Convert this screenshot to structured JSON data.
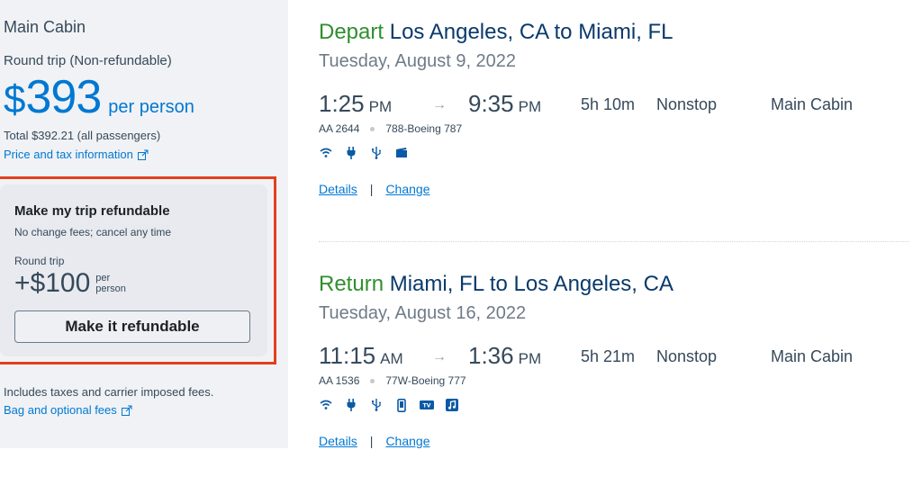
{
  "summary": {
    "cabin": "Main Cabin",
    "trip_type": "Round trip (Non-refundable)",
    "currency": "$",
    "price": "393",
    "per_person": "per person",
    "total": "Total $392.21 (all passengers)",
    "price_tax_link": "Price and tax information",
    "includes": "Includes taxes and carrier imposed fees.",
    "bag_link": "Bag and optional fees"
  },
  "refund": {
    "title": "Make my trip refundable",
    "subtitle": "No change fees; cancel any time",
    "trip_label": "Round trip",
    "amount": "+$100",
    "per_person": "per person",
    "button": "Make it refundable"
  },
  "colors": {
    "accent": "#0078d2",
    "highlight_border": "#e3401c",
    "direction_green": "#2f8f2f"
  },
  "legs": [
    {
      "direction": "Depart",
      "route": "Los Angeles, CA to Miami, FL",
      "date": "Tuesday, August 9, 2022",
      "depart_time": "1:25",
      "depart_ampm": "PM",
      "arrive_time": "9:35",
      "arrive_ampm": "PM",
      "duration": "5h 10m",
      "stops": "Nonstop",
      "cabin": "Main Cabin",
      "flight": "AA 2644",
      "aircraft": "788-Boeing 787",
      "amenities": [
        "wifi-icon",
        "power-icon",
        "usb-icon",
        "entertainment-icon"
      ],
      "details": "Details",
      "change": "Change"
    },
    {
      "direction": "Return",
      "route": "Miami, FL to Los Angeles, CA",
      "date": "Tuesday, August 16, 2022",
      "depart_time": "11:15",
      "depart_ampm": "AM",
      "arrive_time": "1:36",
      "arrive_ampm": "PM",
      "duration": "5h 21m",
      "stops": "Nonstop",
      "cabin": "Main Cabin",
      "flight": "AA 1536",
      "aircraft": "77W-Boeing 777",
      "amenities": [
        "wifi-icon",
        "power-icon",
        "usb-icon",
        "device-icon",
        "tv-icon",
        "music-icon"
      ],
      "details": "Details",
      "change": "Change"
    }
  ]
}
